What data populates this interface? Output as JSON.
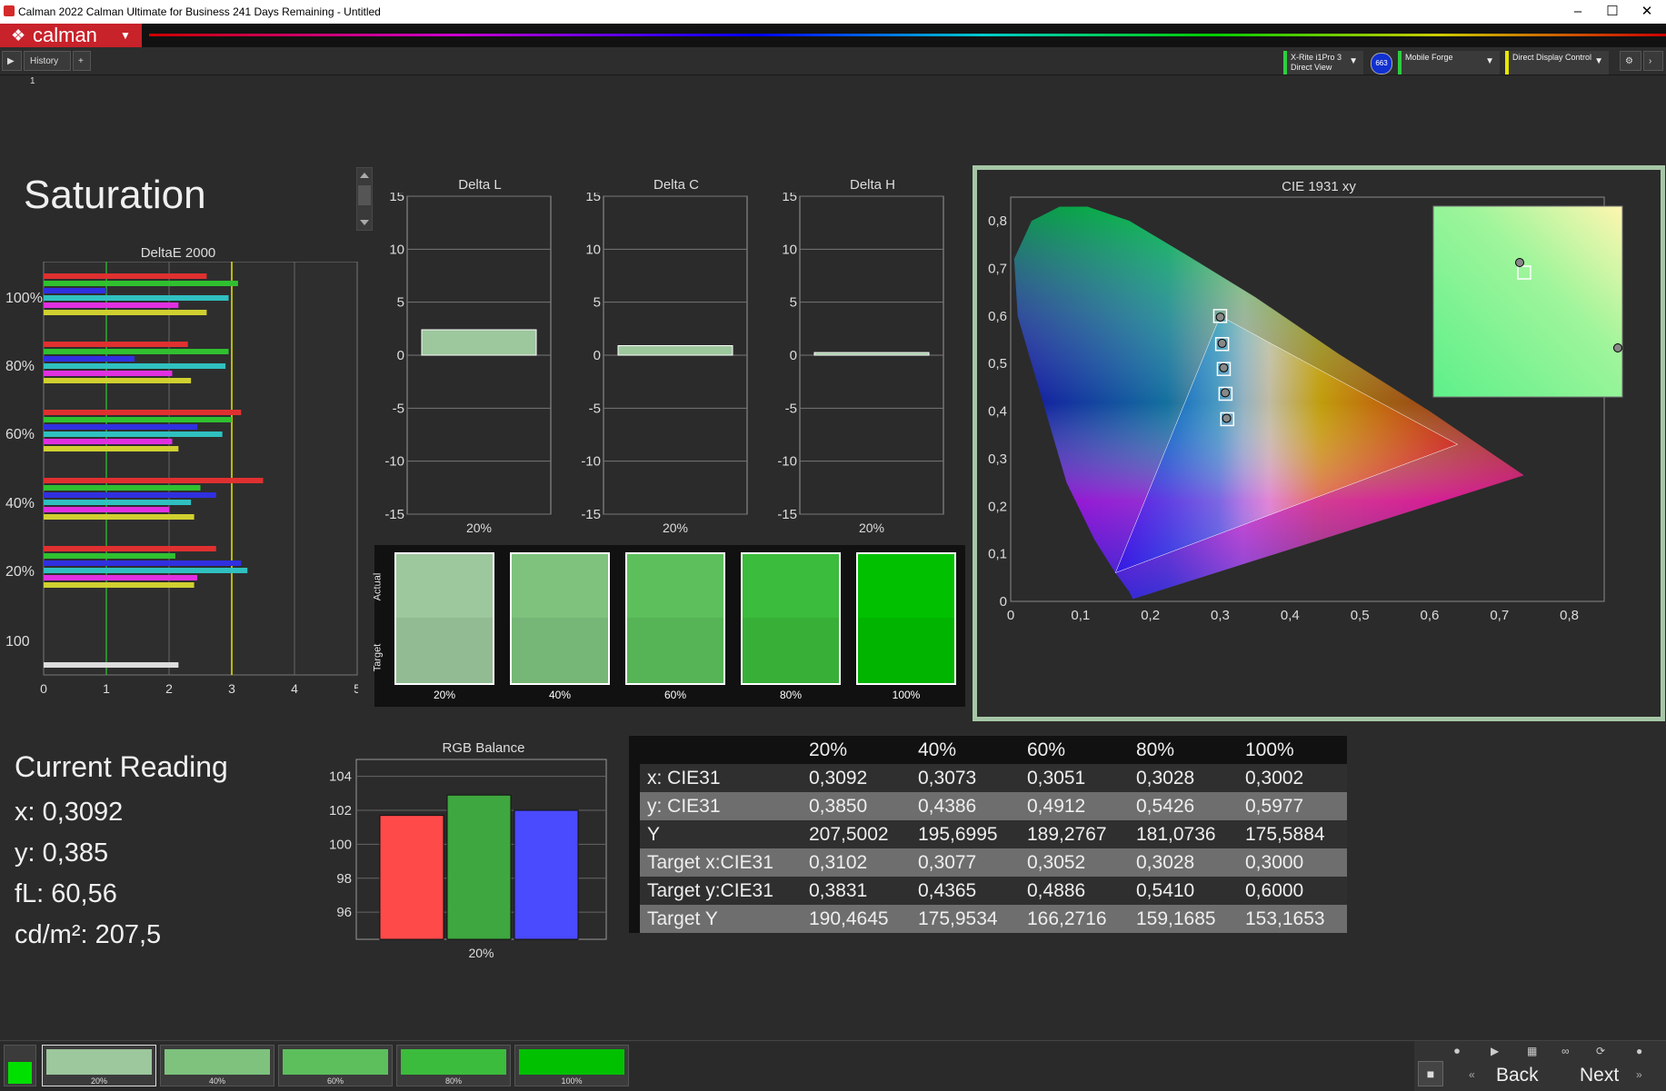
{
  "window": {
    "title": "Calman 2022 Calman Ultimate for Business 241 Days Remaining  - Untitled",
    "minimize": "–",
    "maximize": "☐",
    "close": "✕"
  },
  "app": {
    "logo": "calman",
    "history_tab": "History 1",
    "add_tab": "+"
  },
  "devices": [
    {
      "line1": "X-Rite i1Pro 3",
      "line2": "Direct View",
      "color": "#2ecc40"
    },
    {
      "line1": "Mobile Forge",
      "line2": "",
      "color": "#2ecc40"
    },
    {
      "line1": "Direct Display Control",
      "line2": "",
      "color": "#e8e800"
    }
  ],
  "device_badge": "663",
  "page": {
    "title": "Saturation"
  },
  "deltae": {
    "title": "DeltaE 2000",
    "y_labels": [
      "100%",
      "80%",
      "60%",
      "40%",
      "20%",
      "100"
    ],
    "x_ticks": [
      "0",
      "1",
      "2",
      "3",
      "4",
      "5"
    ]
  },
  "delta_panels": [
    {
      "title": "Delta L",
      "x_label": "20%",
      "y_ticks": [
        "15",
        "10",
        "5",
        "0",
        "-5",
        "-10",
        "-15"
      ],
      "value": 2.4
    },
    {
      "title": "Delta C",
      "x_label": "20%",
      "y_ticks": [
        "15",
        "10",
        "5",
        "0",
        "-5",
        "-10",
        "-15"
      ],
      "value": 0.9
    },
    {
      "title": "Delta H",
      "x_label": "20%",
      "y_ticks": [
        "15",
        "10",
        "5",
        "0",
        "-5",
        "-10",
        "-15"
      ],
      "value": 0.25
    }
  ],
  "swatch_panel": {
    "actual_label": "Actual",
    "target_label": "Target",
    "labels": [
      "20%",
      "40%",
      "60%",
      "80%",
      "100%"
    ]
  },
  "cie": {
    "title": "CIE 1931 xy",
    "x_ticks": [
      "0",
      "0,1",
      "0,2",
      "0,3",
      "0,4",
      "0,5",
      "0,6",
      "0,7",
      "0,8"
    ],
    "y_ticks": [
      "0",
      "0,1",
      "0,2",
      "0,3",
      "0,4",
      "0,5",
      "0,6",
      "0,7",
      "0,8"
    ]
  },
  "current_reading": {
    "title": "Current Reading",
    "x": "x: 0,3092",
    "y": "y: 0,385",
    "fl": "fL: 60,56",
    "cdm2": "cd/m²: 207,5"
  },
  "rgb_balance": {
    "title": "RGB Balance",
    "x_label": "20%",
    "y_ticks": [
      "104",
      "102",
      "100",
      "98",
      "96"
    ]
  },
  "table": {
    "headers": [
      "",
      "20%",
      "40%",
      "60%",
      "80%",
      "100%"
    ],
    "rows": [
      [
        "x: CIE31",
        "0,3092",
        "0,3073",
        "0,3051",
        "0,3028",
        "0,3002"
      ],
      [
        "y: CIE31",
        "0,3850",
        "0,4386",
        "0,4912",
        "0,5426",
        "0,5977"
      ],
      [
        "Y",
        "207,5002",
        "195,6995",
        "189,2767",
        "181,0736",
        "175,5884"
      ],
      [
        "Target x:CIE31",
        "0,3102",
        "0,3077",
        "0,3052",
        "0,3028",
        "0,3000"
      ],
      [
        "Target y:CIE31",
        "0,3831",
        "0,4365",
        "0,4886",
        "0,5410",
        "0,6000"
      ],
      [
        "Target Y",
        "190,4645",
        "175,9534",
        "166,2716",
        "159,1685",
        "153,1653"
      ]
    ]
  },
  "bottom": {
    "swatches": [
      "20%",
      "40%",
      "60%",
      "80%",
      "100%"
    ],
    "back": "Back",
    "next": "Next"
  },
  "colors": {
    "sat20": "#9dc79d",
    "sat40": "#7ec27e",
    "sat60": "#5cbf5c",
    "sat80": "#3cbc3c",
    "sat100": "#00c000",
    "accent": "#c8222a"
  },
  "chart_data": [
    {
      "type": "bar",
      "title": "Delta L",
      "categories": [
        "20%"
      ],
      "values": [
        2.4
      ],
      "ylim": [
        -15,
        15
      ]
    },
    {
      "type": "bar",
      "title": "Delta C",
      "categories": [
        "20%"
      ],
      "values": [
        0.9
      ],
      "ylim": [
        -15,
        15
      ]
    },
    {
      "type": "bar",
      "title": "Delta H",
      "categories": [
        "20%"
      ],
      "values": [
        0.25
      ],
      "ylim": [
        -15,
        15
      ]
    },
    {
      "type": "bar",
      "title": "RGB Balance",
      "categories": [
        "20%"
      ],
      "series": [
        {
          "values": [
            101.7
          ],
          "color": "#ff4a4a"
        },
        {
          "values": [
            102.9
          ],
          "color": "#3fa73f"
        },
        {
          "values": [
            102.0
          ],
          "color": "#4a4aff"
        }
      ],
      "ylim": [
        94.4,
        105
      ]
    },
    {
      "type": "scatter",
      "title": "CIE 1931 xy",
      "xlim": [
        0,
        0.85
      ],
      "ylim": [
        0,
        0.85
      ],
      "series": [
        {
          "values": [
            [
              0.3092,
              0.385
            ],
            [
              0.3073,
              0.4386
            ],
            [
              0.3051,
              0.4912
            ],
            [
              0.3028,
              0.5426
            ],
            [
              0.3002,
              0.5977
            ]
          ]
        },
        {
          "values": [
            [
              0.3102,
              0.3831
            ],
            [
              0.3077,
              0.4365
            ],
            [
              0.3052,
              0.4886
            ],
            [
              0.3028,
              0.541
            ],
            [
              0.3,
              0.6
            ]
          ]
        }
      ]
    },
    {
      "type": "bar",
      "title": "DeltaE 2000",
      "values": [
        2.6,
        3.1,
        1.0,
        2.95,
        2.15,
        2.6,
        2.3,
        2.95,
        1.45,
        2.9,
        2.05,
        2.35,
        3.15,
        3.0,
        2.45,
        2.85,
        2.05,
        2.15,
        3.5,
        2.5,
        2.75,
        2.35,
        2.0,
        2.4,
        2.75,
        2.1,
        3.15,
        3.25,
        2.45,
        2.4,
        2.15
      ],
      "xlim": [
        0,
        5
      ]
    }
  ]
}
